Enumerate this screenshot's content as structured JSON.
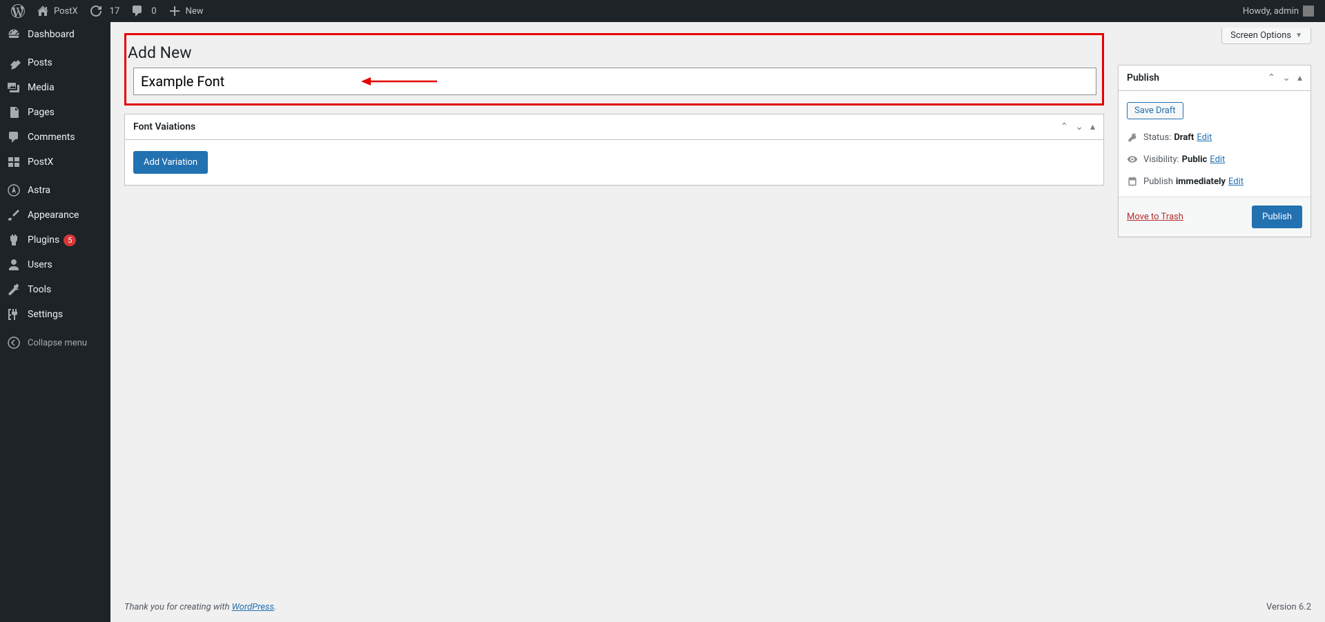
{
  "adminbar": {
    "site_name": "PostX",
    "updates_count": "17",
    "comments_count": "0",
    "new_label": "New",
    "howdy": "Howdy, admin"
  },
  "sidebar": {
    "items": [
      {
        "label": "Dashboard",
        "icon": "dashboard"
      },
      {
        "label": "Posts",
        "icon": "pin"
      },
      {
        "label": "Media",
        "icon": "media"
      },
      {
        "label": "Pages",
        "icon": "page"
      },
      {
        "label": "Comments",
        "icon": "comment"
      },
      {
        "label": "PostX",
        "icon": "postx"
      },
      {
        "label": "Astra",
        "icon": "astra"
      },
      {
        "label": "Appearance",
        "icon": "brush"
      },
      {
        "label": "Plugins",
        "icon": "plugin",
        "badge": "5"
      },
      {
        "label": "Users",
        "icon": "user"
      },
      {
        "label": "Tools",
        "icon": "wrench"
      },
      {
        "label": "Settings",
        "icon": "settings"
      }
    ],
    "collapse_label": "Collapse menu"
  },
  "screen_options_label": "Screen Options",
  "page_title": "Add New",
  "title_input_value": "Example Font",
  "variations_box": {
    "title": "Font Vaiations",
    "add_button": "Add Variation"
  },
  "publish_box": {
    "title": "Publish",
    "save_draft": "Save Draft",
    "status_label": "Status:",
    "status_value": "Draft",
    "visibility_label": "Visibility:",
    "visibility_value": "Public",
    "publish_label": "Publish",
    "publish_value": "immediately",
    "edit_label": "Edit",
    "trash_label": "Move to Trash",
    "publish_button": "Publish"
  },
  "footer": {
    "thank_prefix": "Thank you for creating with ",
    "wp_label": "WordPress",
    "thank_suffix": ".",
    "version": "Version 6.2"
  }
}
